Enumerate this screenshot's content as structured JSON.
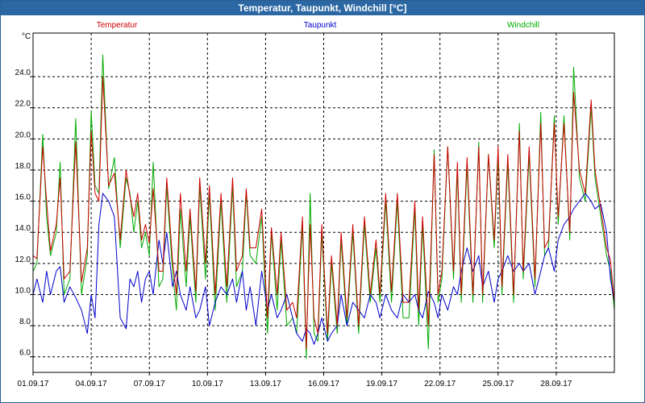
{
  "window": {
    "title": "Temperatur, Taupunkt, Windchill [°C]"
  },
  "chart_data": {
    "type": "line",
    "title": "Temperatur, Taupunkt, Windchill [°C]",
    "ylabel": "°C",
    "ylim": [
      5.0,
      26.8
    ],
    "yticks": [
      6.0,
      8.0,
      10.0,
      12.0,
      14.0,
      16.0,
      18.0,
      20.0,
      22.0,
      24.0
    ],
    "xlim": [
      "2017-09-01",
      "2017-10-01"
    ],
    "xticks": [
      "01.09.17",
      "04.09.17",
      "07.09.17",
      "10.09.17",
      "13.09.17",
      "16.09.17",
      "19.09.17",
      "22.09.17",
      "25.09.17",
      "28.09.17"
    ],
    "xtick_days": [
      1,
      4,
      7,
      10,
      13,
      16,
      19,
      22,
      25,
      28
    ],
    "grid": true,
    "legend": "top",
    "series": [
      {
        "name": "Temperatur",
        "color": "#cc0000",
        "x": [
          1.0,
          1.2,
          1.5,
          1.7,
          1.9,
          2.2,
          2.4,
          2.6,
          2.9,
          3.2,
          3.5,
          3.8,
          4.0,
          4.2,
          4.4,
          4.6,
          4.9,
          5.2,
          5.5,
          5.8,
          6.0,
          6.2,
          6.4,
          6.6,
          6.8,
          7.0,
          7.2,
          7.5,
          7.7,
          7.9,
          8.2,
          8.4,
          8.6,
          8.9,
          9.1,
          9.4,
          9.6,
          9.9,
          10.1,
          10.4,
          10.7,
          11.0,
          11.3,
          11.5,
          11.8,
          12.0,
          12.2,
          12.5,
          12.8,
          13.1,
          13.3,
          13.6,
          13.8,
          14.1,
          14.4,
          14.6,
          14.9,
          15.1,
          15.3,
          15.5,
          15.7,
          15.9,
          16.2,
          16.4,
          16.7,
          16.9,
          17.2,
          17.5,
          17.8,
          18.1,
          18.4,
          18.7,
          18.9,
          19.2,
          19.5,
          19.8,
          20.1,
          20.4,
          20.7,
          20.9,
          21.1,
          21.4,
          21.7,
          21.9,
          22.1,
          22.4,
          22.7,
          22.9,
          23.1,
          23.4,
          23.7,
          24.0,
          24.2,
          24.5,
          24.8,
          25.0,
          25.2,
          25.5,
          25.8,
          26.1,
          26.3,
          26.6,
          26.9,
          27.2,
          27.4,
          27.6,
          27.9,
          28.1,
          28.4,
          28.7,
          28.9,
          29.2,
          29.5,
          29.8,
          30.0,
          30.3,
          30.6,
          30.8,
          31.0
        ],
        "values": [
          12.5,
          12.3,
          19.5,
          16.0,
          12.8,
          14.5,
          17.5,
          11.0,
          11.5,
          19.8,
          10.8,
          13.0,
          20.5,
          16.5,
          16.0,
          24.0,
          17.0,
          17.8,
          13.5,
          18.0,
          16.3,
          15.0,
          16.5,
          13.5,
          14.5,
          13.3,
          16.8,
          11.5,
          11.5,
          17.5,
          12.2,
          10.0,
          16.5,
          11.5,
          15.5,
          10.2,
          17.5,
          12.0,
          17.0,
          10.0,
          16.5,
          10.5,
          17.5,
          11.5,
          12.5,
          16.8,
          13.0,
          13.0,
          15.5,
          8.5,
          14.3,
          10.0,
          14.0,
          9.0,
          9.5,
          8.5,
          15.0,
          6.5,
          14.5,
          8.5,
          7.5,
          14.5,
          7.5,
          12.5,
          8.0,
          14.0,
          8.5,
          14.5,
          8.0,
          15.0,
          10.0,
          13.5,
          10.0,
          16.5,
          10.2,
          16.5,
          9.5,
          9.5,
          16.0,
          9.0,
          15.0,
          8.0,
          19.0,
          10.0,
          11.5,
          19.5,
          11.5,
          18.5,
          10.0,
          18.8,
          10.0,
          19.5,
          10.0,
          19.0,
          13.5,
          19.5,
          10.5,
          19.0,
          10.0,
          20.5,
          11.5,
          19.5,
          11.0,
          21.0,
          13.0,
          13.5,
          21.0,
          15.0,
          21.0,
          14.0,
          23.0,
          18.0,
          16.5,
          22.5,
          18.0,
          15.5,
          13.0,
          12.2,
          9.5
        ]
      },
      {
        "name": "Taupunkt",
        "color": "#0000cc",
        "x": [
          1.0,
          1.2,
          1.5,
          1.7,
          1.9,
          2.2,
          2.4,
          2.6,
          2.9,
          3.2,
          3.5,
          3.8,
          4.0,
          4.2,
          4.4,
          4.6,
          4.9,
          5.2,
          5.5,
          5.8,
          6.0,
          6.2,
          6.4,
          6.6,
          6.8,
          7.0,
          7.2,
          7.5,
          7.7,
          7.9,
          8.2,
          8.4,
          8.6,
          8.9,
          9.1,
          9.4,
          9.6,
          9.9,
          10.1,
          10.4,
          10.7,
          11.0,
          11.3,
          11.5,
          11.8,
          12.0,
          12.2,
          12.5,
          12.8,
          13.1,
          13.3,
          13.6,
          13.8,
          14.1,
          14.4,
          14.6,
          14.9,
          15.1,
          15.3,
          15.5,
          15.7,
          15.9,
          16.2,
          16.4,
          16.7,
          16.9,
          17.2,
          17.5,
          17.8,
          18.1,
          18.4,
          18.7,
          18.9,
          19.2,
          19.5,
          19.8,
          20.1,
          20.4,
          20.7,
          20.9,
          21.1,
          21.4,
          21.7,
          21.9,
          22.1,
          22.4,
          22.7,
          22.9,
          23.1,
          23.4,
          23.7,
          24.0,
          24.2,
          24.5,
          24.8,
          25.0,
          25.2,
          25.5,
          25.8,
          26.1,
          26.3,
          26.6,
          26.9,
          27.2,
          27.4,
          27.6,
          27.9,
          28.1,
          28.4,
          28.7,
          28.9,
          29.2,
          29.5,
          29.8,
          30.0,
          30.3,
          30.6,
          30.8,
          31.0
        ],
        "values": [
          10.0,
          11.0,
          9.5,
          11.5,
          10.0,
          11.5,
          11.8,
          9.5,
          10.5,
          9.8,
          9.0,
          7.5,
          10.0,
          8.5,
          14.5,
          16.5,
          16.0,
          15.0,
          8.5,
          7.8,
          11.0,
          10.5,
          11.5,
          9.5,
          11.0,
          11.5,
          10.0,
          13.5,
          12.0,
          14.0,
          10.5,
          11.5,
          10.0,
          9.0,
          10.5,
          8.5,
          9.0,
          10.5,
          8.0,
          9.5,
          10.5,
          10.0,
          11.0,
          9.5,
          11.5,
          9.0,
          10.5,
          8.0,
          11.5,
          9.0,
          10.0,
          8.5,
          9.0,
          10.0,
          8.5,
          7.5,
          7.0,
          7.8,
          7.5,
          6.8,
          7.5,
          8.5,
          7.0,
          7.5,
          8.0,
          10.0,
          8.0,
          9.5,
          9.0,
          8.5,
          10.0,
          9.5,
          8.5,
          10.0,
          9.0,
          8.5,
          10.0,
          9.5,
          10.0,
          9.0,
          8.5,
          10.2,
          9.5,
          8.5,
          10.0,
          9.0,
          10.5,
          10.0,
          11.5,
          13.0,
          11.5,
          12.5,
          10.5,
          11.5,
          9.5,
          11.0,
          11.5,
          12.5,
          11.5,
          12.0,
          11.5,
          12.0,
          10.0,
          11.5,
          12.5,
          13.0,
          11.5,
          13.5,
          14.5,
          15.0,
          15.5,
          16.0,
          16.5,
          16.0,
          15.5,
          15.8,
          14.0,
          11.0,
          9.5
        ]
      },
      {
        "name": "Windchill",
        "color": "#00aa00",
        "x": [
          1.0,
          1.2,
          1.5,
          1.7,
          1.9,
          2.2,
          2.4,
          2.6,
          2.9,
          3.2,
          3.5,
          3.8,
          4.0,
          4.2,
          4.4,
          4.6,
          4.9,
          5.2,
          5.5,
          5.8,
          6.0,
          6.2,
          6.4,
          6.6,
          6.8,
          7.0,
          7.2,
          7.5,
          7.7,
          7.9,
          8.2,
          8.4,
          8.6,
          8.9,
          9.1,
          9.4,
          9.6,
          9.9,
          10.1,
          10.4,
          10.7,
          11.0,
          11.3,
          11.5,
          11.8,
          12.0,
          12.2,
          12.5,
          12.8,
          13.1,
          13.3,
          13.6,
          13.8,
          14.1,
          14.4,
          14.6,
          14.9,
          15.1,
          15.3,
          15.5,
          15.7,
          15.9,
          16.2,
          16.4,
          16.7,
          16.9,
          17.2,
          17.5,
          17.8,
          18.1,
          18.4,
          18.7,
          18.9,
          19.2,
          19.5,
          19.8,
          20.1,
          20.4,
          20.7,
          20.9,
          21.1,
          21.4,
          21.7,
          21.9,
          22.1,
          22.4,
          22.7,
          22.9,
          23.1,
          23.4,
          23.7,
          24.0,
          24.2,
          24.5,
          24.8,
          25.0,
          25.2,
          25.5,
          25.8,
          26.1,
          26.3,
          26.6,
          26.9,
          27.2,
          27.4,
          27.6,
          27.9,
          28.1,
          28.4,
          28.7,
          28.9,
          29.2,
          29.5,
          29.8,
          30.0,
          30.3,
          30.6,
          30.8,
          31.0
        ],
        "values": [
          11.5,
          12.0,
          20.3,
          15.0,
          12.5,
          14.0,
          18.5,
          10.0,
          11.0,
          21.3,
          10.0,
          12.5,
          21.8,
          17.0,
          16.5,
          25.4,
          16.8,
          18.8,
          13.0,
          17.5,
          16.5,
          14.0,
          16.0,
          13.0,
          14.0,
          12.5,
          18.5,
          10.5,
          11.0,
          17.0,
          11.5,
          9.0,
          15.5,
          10.5,
          15.0,
          9.5,
          17.0,
          11.0,
          16.5,
          9.0,
          16.0,
          9.5,
          17.0,
          10.5,
          11.5,
          16.5,
          12.5,
          12.0,
          15.0,
          7.5,
          14.0,
          9.0,
          13.5,
          8.0,
          8.5,
          7.5,
          14.5,
          5.9,
          16.5,
          7.5,
          7.0,
          14.0,
          7.0,
          12.0,
          7.5,
          13.5,
          8.0,
          14.0,
          7.5,
          14.5,
          9.5,
          13.0,
          9.5,
          16.0,
          9.5,
          16.0,
          8.5,
          8.5,
          15.5,
          8.0,
          14.5,
          6.5,
          19.3,
          9.5,
          11.0,
          19.5,
          11.0,
          18.0,
          9.5,
          18.3,
          9.5,
          19.8,
          9.5,
          19.0,
          13.0,
          19.0,
          10.0,
          18.5,
          9.5,
          21.0,
          11.0,
          19.0,
          10.5,
          21.7,
          12.5,
          13.0,
          21.5,
          14.5,
          21.5,
          13.5,
          24.6,
          17.5,
          16.0,
          22.0,
          17.5,
          15.0,
          12.5,
          11.5,
          9.0
        ]
      }
    ]
  }
}
